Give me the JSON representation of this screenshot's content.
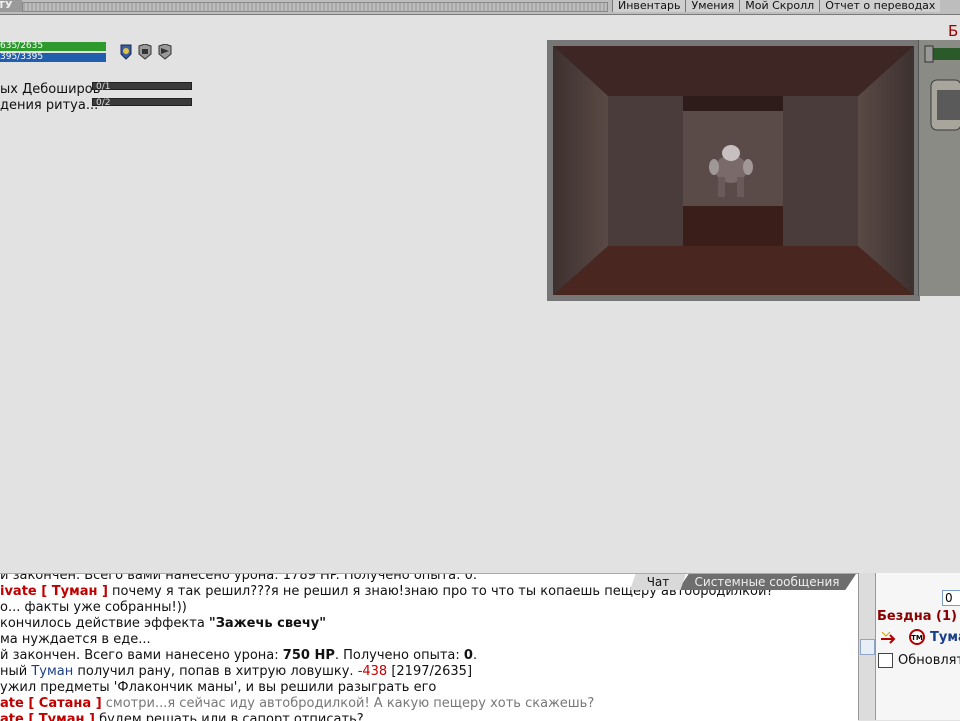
{
  "header": {
    "logo_text": "ТУ",
    "menu": [
      "Инвентарь",
      "Умения",
      "Мой Скролл",
      "Отчет о переводах"
    ],
    "right_char": "Б"
  },
  "character": {
    "hp_text": "635/2635",
    "mana_text": "395/3395",
    "effects": [
      "effect-shield-icon",
      "effect-helmet-icon",
      "effect-helmet-icon"
    ]
  },
  "quests": [
    {
      "name": "ых Дебоширов",
      "progress": "0/1"
    },
    {
      "name": "дения ритуа...",
      "progress": "0/2"
    }
  ],
  "chat": {
    "tabs": [
      "Чат",
      "Системные сообщения"
    ],
    "lines": [
      {
        "parts": [
          {
            "t": "й закончен. Всего вами нанесено урона: 1789 HP. Получено опыта: 0."
          }
        ]
      },
      {
        "parts": [
          {
            "t": "ivate [ Туман ]",
            "c": "private"
          },
          {
            "t": " почему я так решил???я не решил я знаю!знаю про то что ты копаешь пещеру автобродилкой?"
          }
        ]
      },
      {
        "parts": [
          {
            "t": "о... факты уже собранны!))"
          }
        ]
      },
      {
        "parts": [
          {
            "t": "кончилось действие эффекта "
          },
          {
            "t": "\"Зажечь свечу\"",
            "c": "bold"
          }
        ]
      },
      {
        "parts": [
          {
            "t": "ма нуждается в еде..."
          }
        ]
      },
      {
        "parts": [
          {
            "t": "й закончен. Всего вами нанесено урона: "
          },
          {
            "t": "750 HP",
            "c": "bold"
          },
          {
            "t": ". Получено опыта: "
          },
          {
            "t": "0",
            "c": "bold"
          },
          {
            "t": "."
          }
        ]
      },
      {
        "parts": [
          {
            "t": "ный "
          },
          {
            "t": "Туман",
            "c": "nick"
          },
          {
            "t": " получил рану, попав в хитрую ловушку. "
          },
          {
            "t": "-438",
            "c": "dmg"
          },
          {
            "t": " [2197/2635]"
          }
        ]
      },
      {
        "parts": [
          {
            "t": "ужил предметы 'Флакончик маны', и вы решили разыграть его"
          }
        ]
      },
      {
        "parts": [
          {
            "t": "ate [ Сатана ]",
            "c": "private"
          },
          {
            "t": " смотри...я сейчас иду автобродилкой! А какую пещеру хоть скажешь?",
            "c": "grey"
          }
        ]
      },
      {
        "parts": [
          {
            "t": "ate [ Туман ]",
            "c": "private"
          },
          {
            "t": " будем решать или в сапорт отписать?"
          }
        ]
      }
    ]
  },
  "side": {
    "input_value": "0",
    "location": "Бездна (1)",
    "member_badge": "TM",
    "member_name": "Туман",
    "refresh_label": "Обновлять"
  }
}
